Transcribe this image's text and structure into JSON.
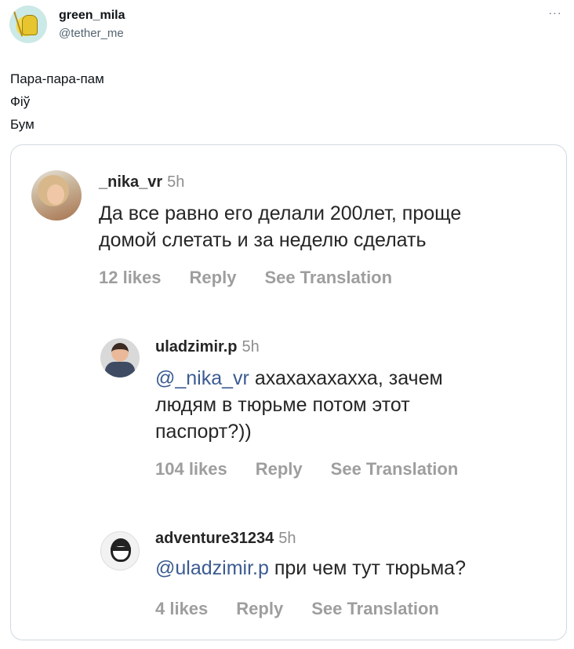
{
  "tweet": {
    "username": "green_mila",
    "handle": "@tether_me",
    "more_icon": "···",
    "lines": [
      "Пара-пара-пам",
      "Фіў",
      "Бум"
    ]
  },
  "comments": [
    {
      "username": "_nika_vr",
      "time": "5h",
      "mention": "",
      "text_lines": [
        "Да все равно его делали 200лет, проще",
        "домой слетать и за неделю сделать"
      ],
      "likes": "12 likes",
      "reply": "Reply",
      "translate": "See Translation"
    },
    {
      "username": "uladzimir.p",
      "time": "5h",
      "mention": "@_nika_vr",
      "text_lines": [
        " ахахахахахха, зачем",
        "людям в тюрьме потом этот",
        "паспорт?))"
      ],
      "likes": "104 likes",
      "reply": "Reply",
      "translate": "See Translation"
    },
    {
      "username": "adventure31234",
      "time": "5h",
      "mention": "@uladzimir.p",
      "text_lines": [
        " при чем тут тюрьма?"
      ],
      "likes": "4 likes",
      "reply": "Reply",
      "translate": "See Translation"
    }
  ]
}
